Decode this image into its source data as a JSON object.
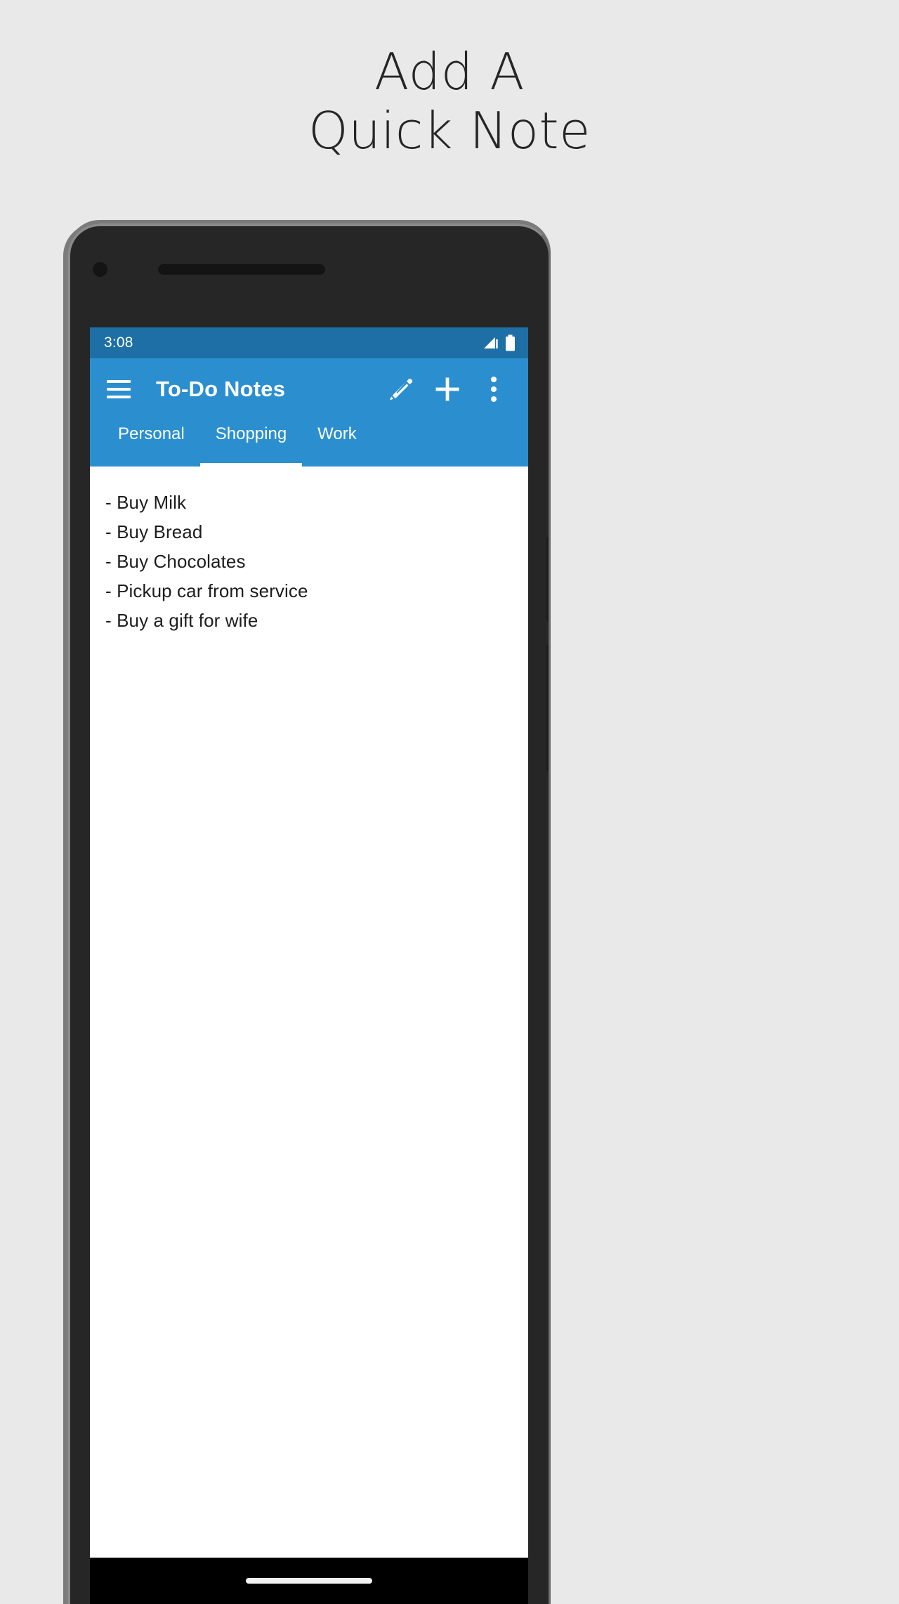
{
  "promo": {
    "line1": "Add A",
    "line2": "Quick Note"
  },
  "phone": {
    "camera_icon": "camera-dot",
    "speaker_icon": "earpiece-speaker",
    "side_buttons": [
      "volume-rocker",
      "power-button"
    ]
  },
  "statusbar": {
    "time": "3:08",
    "icons": [
      "signal-icon",
      "battery-icon"
    ],
    "bg": "#1d6fa5"
  },
  "appbar": {
    "menu_icon": "hamburger-menu-icon",
    "title": "To-Do Notes",
    "actions": [
      {
        "name": "edit-icon",
        "label": "Edit"
      },
      {
        "name": "add-icon",
        "label": "Add"
      },
      {
        "name": "overflow-menu-icon",
        "label": "More options"
      }
    ],
    "bg": "#2b8fcf"
  },
  "tabs": {
    "active_index": 1,
    "items": [
      {
        "label": "Personal"
      },
      {
        "label": "Shopping"
      },
      {
        "label": "Work"
      }
    ]
  },
  "note": {
    "lines": [
      "- Buy Milk",
      "- Buy Bread",
      "- Buy Chocolates",
      "- Pickup car from service",
      "- Buy a gift for wife"
    ]
  },
  "navbar": {
    "gesture_pill": "home-gesture-pill"
  },
  "colors": {
    "page_bg": "#e9e9e9",
    "accent": "#2b8fcf",
    "accent_dark": "#1d6fa5",
    "bezel": "#262626",
    "text": "#1d1d1d"
  }
}
